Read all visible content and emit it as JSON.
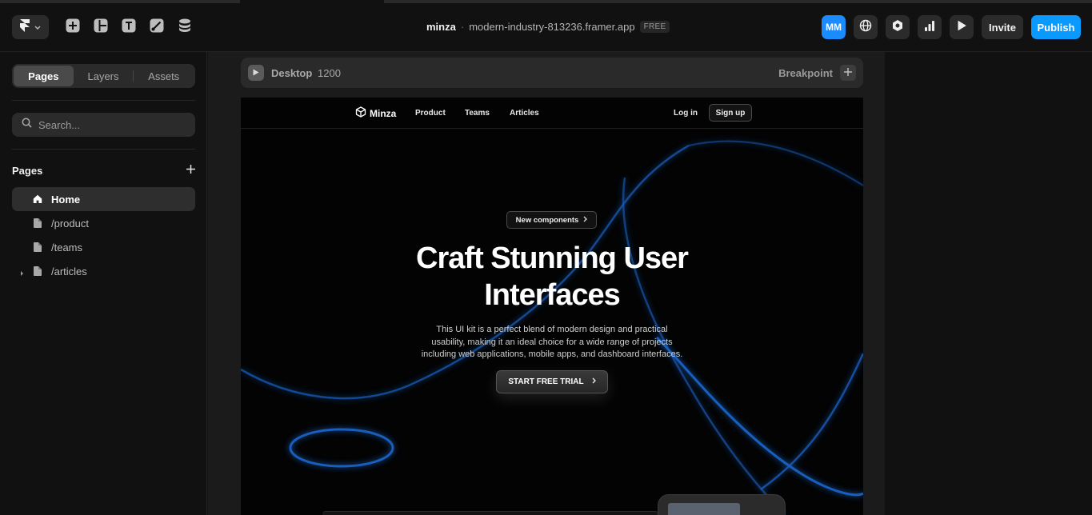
{
  "toolbar": {
    "project_name": "minza",
    "separator": "·",
    "project_domain": "modern-industry-813236.framer.app",
    "plan_badge": "FREE",
    "avatar_initials": "MM",
    "invite_label": "Invite",
    "publish_label": "Publish",
    "icons": [
      "framer-logo-icon",
      "chevron-down-icon",
      "insert-icon",
      "layout-icon",
      "text-icon",
      "vector-icon",
      "cms-icon",
      "globe-icon",
      "settings-icon",
      "analytics-icon",
      "play-icon"
    ]
  },
  "sidebar": {
    "tabs": [
      {
        "label": "Pages",
        "active": true
      },
      {
        "label": "Layers",
        "active": false
      },
      {
        "label": "Assets",
        "active": false
      }
    ],
    "search_placeholder": "Search...",
    "pages_title": "Pages",
    "pages": [
      {
        "label": "Home",
        "icon": "home-icon",
        "active": true
      },
      {
        "label": "/product",
        "icon": "page-icon",
        "active": false
      },
      {
        "label": "/teams",
        "icon": "page-icon",
        "active": false
      },
      {
        "label": "/articles",
        "icon": "page-icon",
        "active": false,
        "collapsed_children": true
      }
    ]
  },
  "canvas": {
    "breakpoint_name": "Desktop",
    "breakpoint_width": "1200",
    "breakpoint_label": "Breakpoint"
  },
  "site": {
    "brand": "Minza",
    "nav": [
      "Product",
      "Teams",
      "Articles"
    ],
    "login": "Log in",
    "signup": "Sign up",
    "pill": "New components",
    "headline_line1": "Craft Stunning User",
    "headline_line2": "Interfaces",
    "sub_line1": "This UI kit is a perfect blend of modern design and practical",
    "sub_line2": "usability, making it an ideal choice for a wide range of projects",
    "sub_line3": "including web applications, mobile apps, and dashboard interfaces.",
    "cta": "START FREE TRIAL",
    "accent_glow": "#1f6fe0"
  },
  "colors": {
    "app_bg": "#111111",
    "canvas_bg": "#1b1b1b",
    "publish_blue": "#0a99ff",
    "avatar_blue": "#1a8cff"
  }
}
